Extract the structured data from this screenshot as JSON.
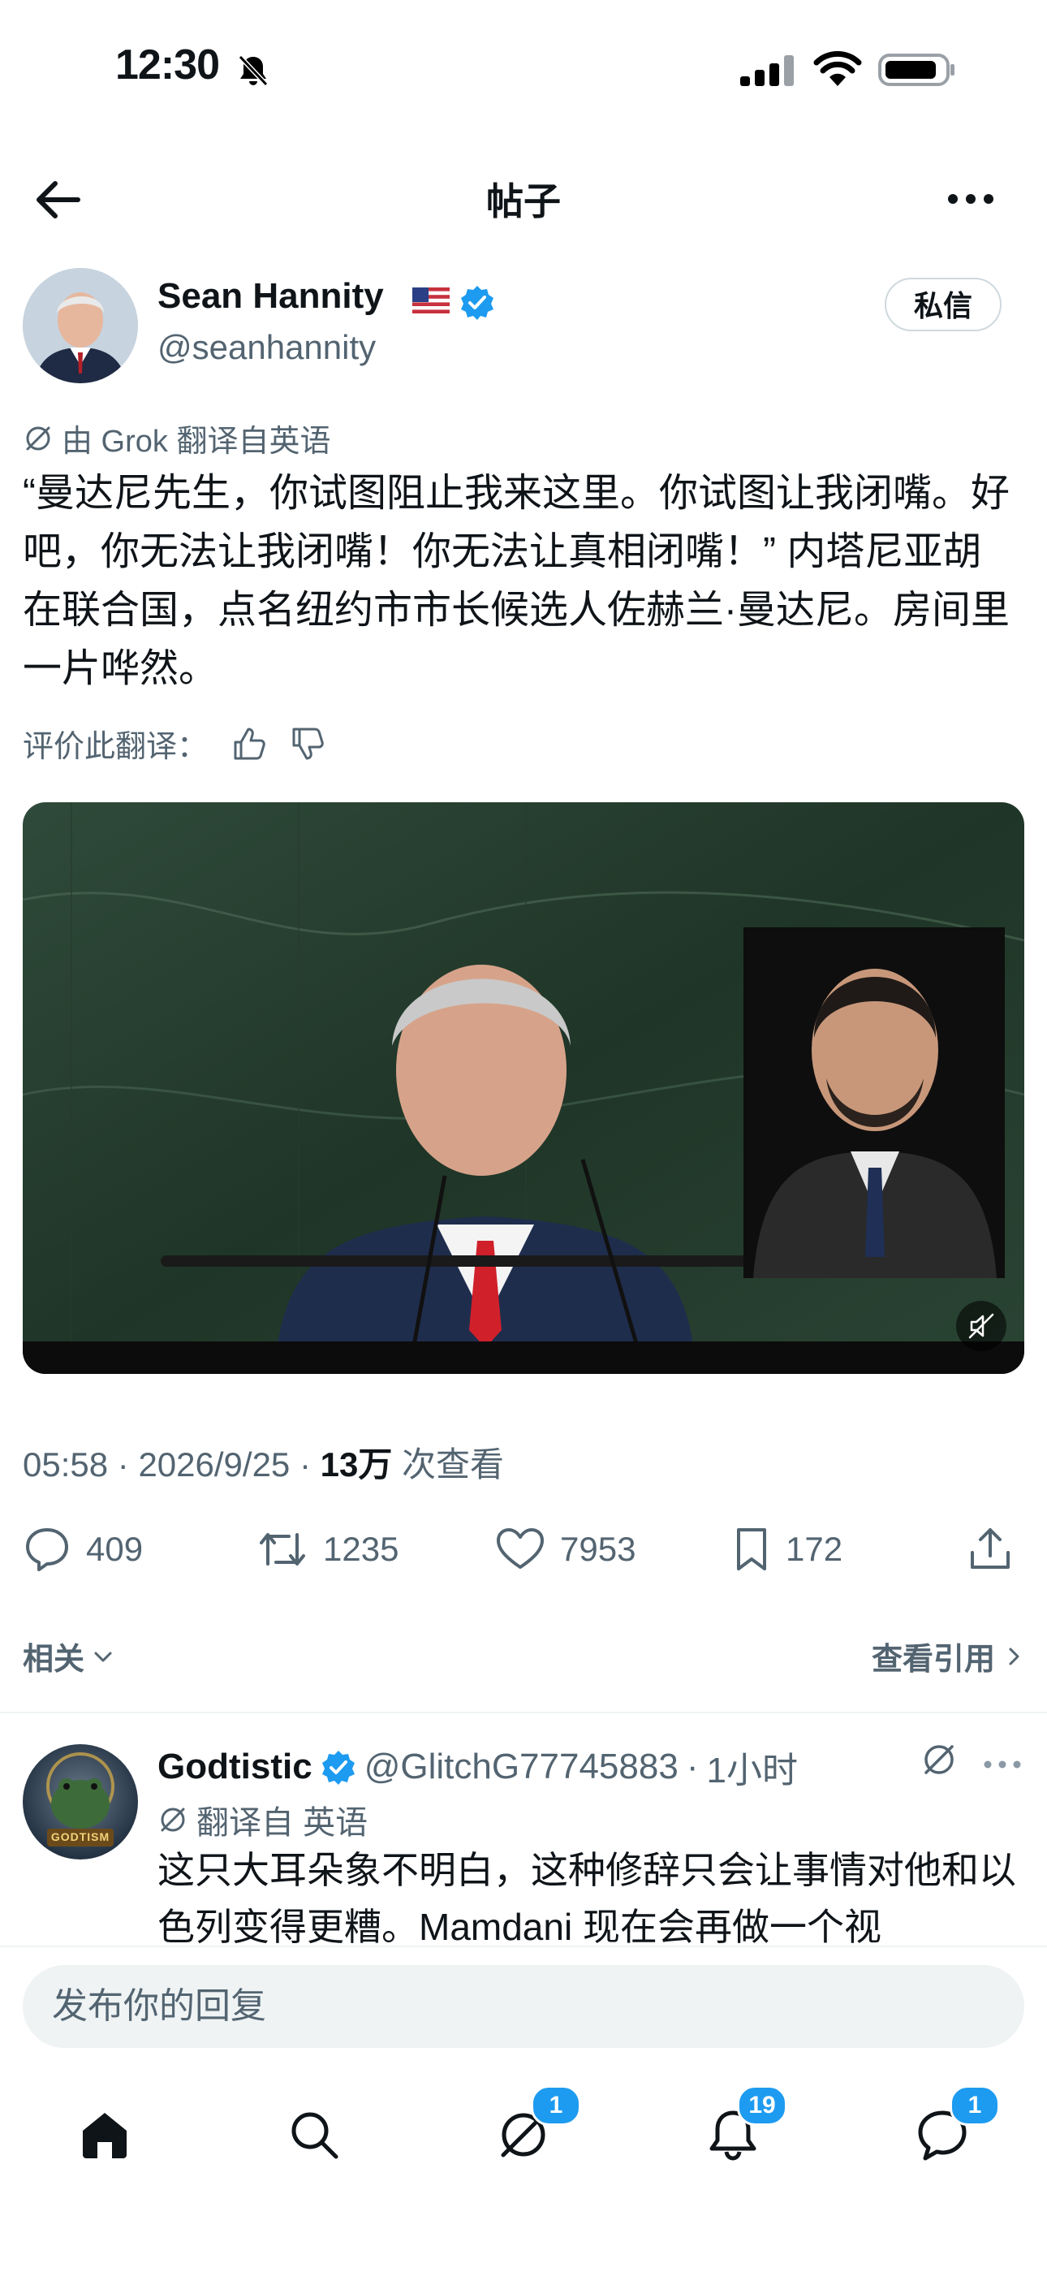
{
  "status_bar": {
    "time": "12:30"
  },
  "header": {
    "title": "帖子"
  },
  "post": {
    "author_name": "Sean Hannity",
    "author_handle": "@seanhannity",
    "dm_label": "私信",
    "translation_note": "由 Grok 翻译自英语",
    "text": "“曼达尼先生，你试图阻止我来这里。你试图让我闭嘴。好吧，你无法让我闭嘴！你无法让真相闭嘴！” 内塔尼亚胡在联合国，点名纽约市市长候选人佐赫兰·曼达尼。房间里一片哗然。",
    "rate_label": "评价此翻译：",
    "time": "05:58",
    "date": "2026/9/25",
    "views_count": "13万",
    "views_label": "次查看",
    "reply_count": "409",
    "retweet_count": "1235",
    "like_count": "7953",
    "bookmark_count": "172"
  },
  "related": {
    "label": "相关",
    "quotes_label": "查看引用"
  },
  "reply": {
    "name": "Godtistic",
    "handle": "@GlitchG77745883",
    "time": "1小时",
    "translation_note": "翻译自 英语",
    "text": "这只大耳朵象不明白，这种修辞只会让事情对他和以色列变得更糟。Mamdani 现在会再做一个视",
    "avatar_caption": "GODTISM"
  },
  "composer": {
    "placeholder": "发布你的回复"
  },
  "tab_bar": {
    "items": [
      {
        "icon": "home-icon"
      },
      {
        "icon": "search-icon"
      },
      {
        "icon": "grok-icon",
        "badge": "1"
      },
      {
        "icon": "bell-icon",
        "badge": "19"
      },
      {
        "icon": "messages-icon",
        "badge": "1"
      }
    ]
  },
  "colors": {
    "accent": "#1d9bf0",
    "text": "#0f1419",
    "secondary": "#536471",
    "like": "#f91880"
  }
}
